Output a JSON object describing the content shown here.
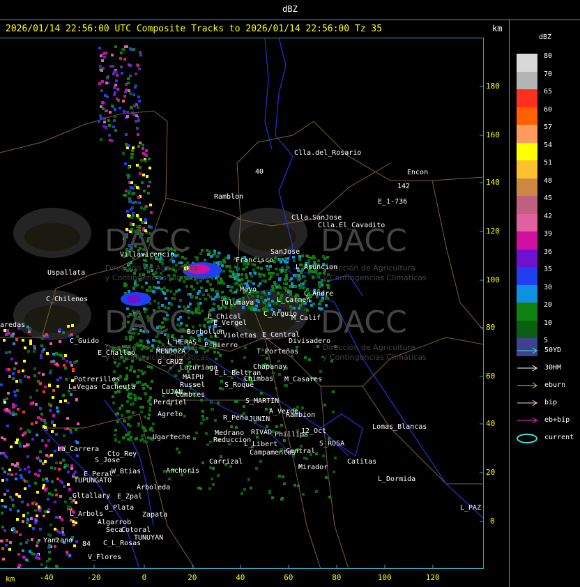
{
  "top_title": "dBZ",
  "header": "2026/01/14 22:56:00 UTC Composite Tracks to 2026/01/14 22:56:00 Tz 35",
  "km_label": "km",
  "y_axis_ticks": [
    "180",
    "160",
    "140",
    "120",
    "100",
    "80",
    "60",
    "40",
    "20",
    "0"
  ],
  "x_axis_ticks": [
    "-40",
    "-20",
    "0",
    "20",
    "40",
    "60",
    "80",
    "100",
    "120"
  ],
  "legend": {
    "title": "dBZ",
    "scale": [
      {
        "label": "80",
        "color": "#d8d8d8"
      },
      {
        "label": "70",
        "color": "#b4b4b4"
      },
      {
        "label": "65",
        "color": "#ff3020"
      },
      {
        "label": "60",
        "color": "#ff6000"
      },
      {
        "label": "57",
        "color": "#ff9a60"
      },
      {
        "label": "54",
        "color": "#ffff00"
      },
      {
        "label": "51",
        "color": "#ffc030"
      },
      {
        "label": "48",
        "color": "#cc8840"
      },
      {
        "label": "45",
        "color": "#c06080"
      },
      {
        "label": "42",
        "color": "#e060a0"
      },
      {
        "label": "39",
        "color": "#d010a0"
      },
      {
        "label": "36",
        "color": "#7010d0"
      },
      {
        "label": "35",
        "color": "#2040f0"
      },
      {
        "label": "30",
        "color": "#1090e0"
      },
      {
        "label": "20",
        "color": "#108010"
      },
      {
        "label": "10",
        "color": "#0a6010"
      },
      {
        "label": "5",
        "color": "#404090"
      }
    ],
    "tracks": [
      {
        "label": "50YD",
        "color": "#40e0e0"
      },
      {
        "label": "30HM",
        "color": "#ffffff"
      },
      {
        "label": "eburn",
        "color": "#f0c060"
      },
      {
        "label": "bip",
        "color": "#ffd0e0"
      },
      {
        "label": "eb+bip",
        "color": "#e040e0"
      },
      {
        "label": "current",
        "color": "#40e0e0"
      }
    ]
  },
  "watermark": {
    "brand": "DACC",
    "line1": "Dirección de Agricultura",
    "line2": "y Contingencias Climáticas"
  },
  "places": [
    "Clla.del_Rosario",
    "Encon",
    "142",
    "E_1-736",
    "Ramblon",
    "40",
    "Clla.SanJose",
    "Clla.El_Cavadito",
    "Villavicencio",
    "Francisco",
    "SanJose",
    "L_Asuncion",
    "Uspallata",
    "C_Andre",
    "L_Carmen",
    "Mayo",
    "C_Chilenos",
    "Tulumaya",
    "E_Chical",
    "E_Vergel",
    "C_Arguio",
    "M_Calif",
    "aredas",
    "Borbollon",
    "L_Violetas",
    "E_Central",
    "Divisadero",
    "C_Guido",
    "L_HERAS",
    "P_Hierro",
    "E_Challao",
    "MENDOZA",
    "T_Porteñas",
    "G_CRUZ",
    "Luzuriaga",
    "Chapanay",
    "E_L_Beltran",
    "Chimbas",
    "M_Casares",
    "Potrerillos",
    "MAIPU",
    "Russel",
    "L_Vegas",
    "Cacheuta",
    "S_Roque",
    "LUJAN",
    "Cumbres",
    "S_MARTIN",
    "Perdriel",
    "Agrelo",
    "R_Peña",
    "JUNIN",
    "A_Verde",
    "Rambion",
    "Lomas_Blancas",
    "12_Oct",
    "Ugarteche",
    "Medrano",
    "RIVAD",
    "Phillips",
    "Reduccion",
    "L_Libert",
    "S_ROSA",
    "La_Carrera",
    "Cto_Rey",
    "Campamentos",
    "Central",
    "S_Jose",
    "Carrizal",
    "Catitas",
    "E_Peral",
    "W_Btias",
    "Anchoris",
    "TUPUNGATO",
    "Mirador",
    "L_Dormida",
    "Arboleda",
    "Gltallary",
    "E_Zpal",
    "d_Plata",
    "L_Arbols",
    "Zapata",
    "L_PAZ",
    "Algarrob",
    "Seca",
    "Cotoral",
    "TUNUYAN",
    "Yanzano",
    "84",
    "C_L_Rosas",
    "V_Flores"
  ]
}
